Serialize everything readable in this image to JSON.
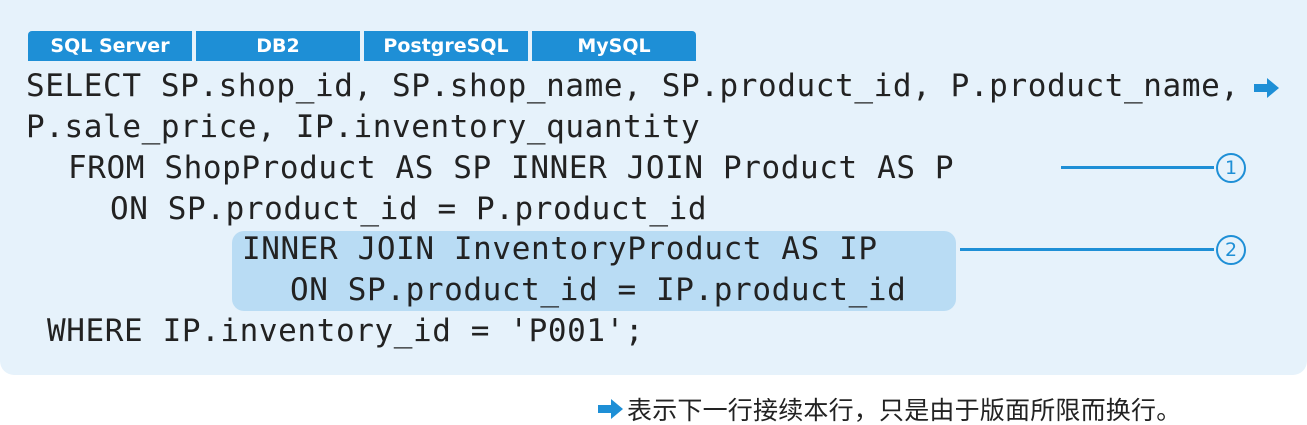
{
  "tabs": [
    {
      "label": "SQL Server"
    },
    {
      "label": "DB2"
    },
    {
      "label": "PostgreSQL"
    },
    {
      "label": "MySQL"
    }
  ],
  "code": {
    "lines": [
      "SELECT SP.shop_id, SP.shop_name, SP.product_id, P.product_name,",
      "P.sale_price, IP.inventory_quantity",
      "FROM ShopProduct AS SP INNER JOIN Product AS P",
      "ON SP.product_id = P.product_id",
      "INNER JOIN InventoryProduct AS IP",
      "ON SP.product_id = IP.product_id",
      "WHERE IP.inventory_id = 'P001';"
    ]
  },
  "callouts": [
    {
      "number": "1"
    },
    {
      "number": "2"
    }
  ],
  "icons": {
    "continuation": "right-arrow-icon"
  },
  "footnote": {
    "text": "表示下一行接续本行，只是由于版面所限而换行。"
  },
  "colors": {
    "panel_background": "#e6f2fb",
    "tab_background": "#1e8fd6",
    "highlight_background": "#b9dcf4",
    "accent": "#1e8fd6",
    "code_text": "#222222"
  }
}
